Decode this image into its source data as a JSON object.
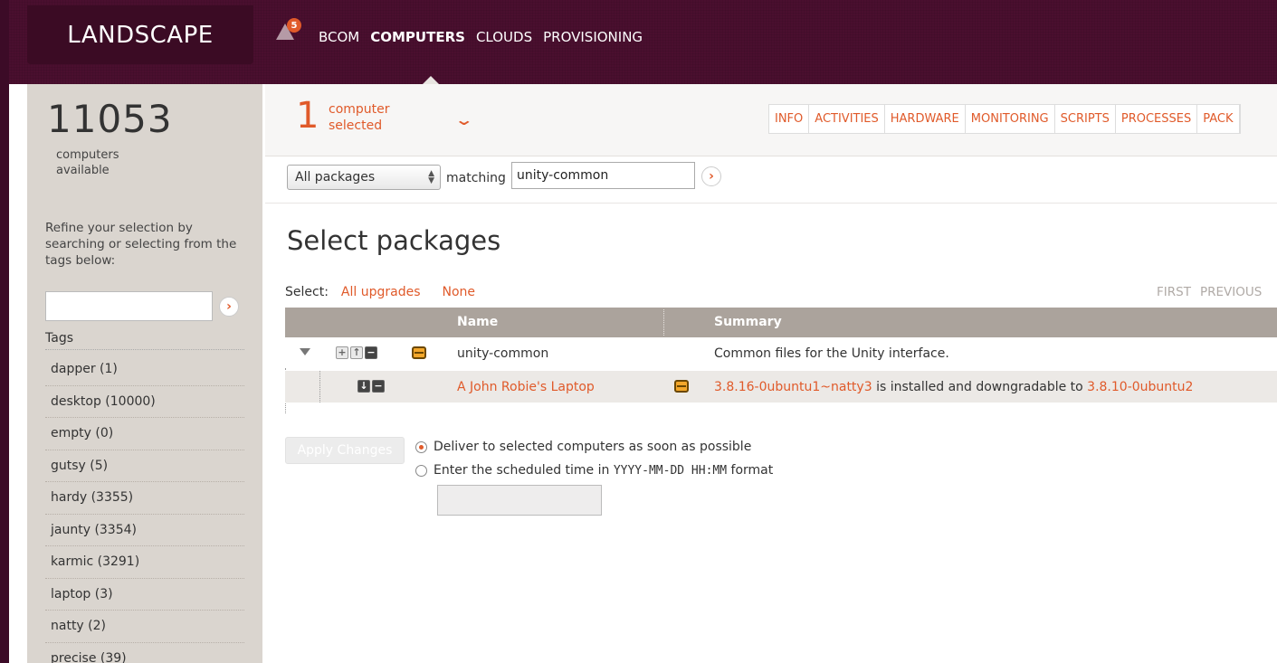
{
  "header": {
    "logo": "LANDSCAPE",
    "alert_count": "5",
    "nav": [
      "BCOM",
      "COMPUTERS",
      "CLOUDS",
      "PROVISIONING"
    ],
    "active_nav": "COMPUTERS"
  },
  "sidebar": {
    "count": "11053",
    "count_label_line1": "computers",
    "count_label_line2": "available",
    "refine_text": "Refine your selection by searching or selecting from the tags below:",
    "search_value": "",
    "tags_heading": "Tags",
    "tags": [
      "dapper (1)",
      "desktop (10000)",
      "empty (0)",
      "gutsy (5)",
      "hardy (3355)",
      "jaunty (3354)",
      "karmic (3291)",
      "laptop (3)",
      "natty (2)",
      "precise (39)"
    ]
  },
  "selection": {
    "number": "1",
    "label_line1": "computer",
    "label_line2": "selected"
  },
  "tabs": [
    "INFO",
    "ACTIVITIES",
    "HARDWARE",
    "MONITORING",
    "SCRIPTS",
    "PROCESSES",
    "PACK"
  ],
  "filter": {
    "select_value": "All packages",
    "matching_label": "matching",
    "query": "unity-common"
  },
  "page": {
    "title": "Select packages",
    "select_label": "Select:",
    "select_all_upgrades": "All upgrades",
    "select_none": "None",
    "pager": [
      "FIRST",
      "PREVIOUS"
    ]
  },
  "table": {
    "col_name": "Name",
    "col_summary": "Summary",
    "package": {
      "name": "unity-common",
      "summary": "Common files for the Unity interface."
    },
    "computer_row": {
      "name": "A John Robie's Laptop",
      "installed_version": "3.8.16-0ubuntu1~natty3",
      "middle_text": " is installed and downgradable to ",
      "target_version": "3.8.10-0ubuntu2"
    }
  },
  "apply": {
    "button_label": "Apply Changes",
    "option_asap": "Deliver to selected computers as soon as possible",
    "option_scheduled_prefix": "Enter the scheduled time in ",
    "option_scheduled_format": "YYYY-MM-DD HH:MM",
    "option_scheduled_suffix": " format",
    "scheduled_value": ""
  },
  "colors": {
    "accent": "#e05a2a",
    "header_bg": "#4a0f2f",
    "sidebar_bg": "#dad5cf",
    "table_header_bg": "#aba39c"
  }
}
